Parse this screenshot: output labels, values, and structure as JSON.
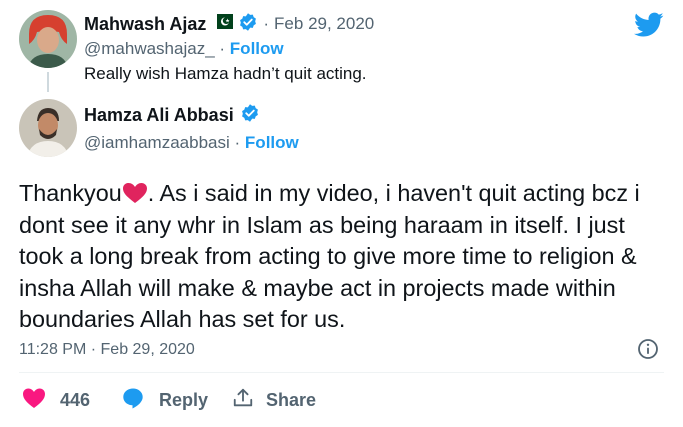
{
  "colors": {
    "brand_blue": "#1d9bf0",
    "like_pink": "#f91880",
    "text_primary": "#0f1419",
    "text_secondary": "#536471",
    "heart_red": "#e0245e"
  },
  "header_icon": "twitter-bird-icon",
  "parent_tweet": {
    "name": "Mahwash Ajaz",
    "flag_icon": "pakistan-flag-icon",
    "verified_icon": "verified-badge-icon",
    "date_sep": "·",
    "date": "Feb 29, 2020",
    "handle": "@mahwashajaz_",
    "dot": "·",
    "follow_label": "Follow",
    "text": "Really wish Hamza hadn’t quit acting."
  },
  "main_tweet": {
    "name": "Hamza Ali Abbasi",
    "verified_icon": "verified-badge-icon",
    "handle": "@iamhamzaabbasi",
    "dot": "·",
    "follow_label": "Follow",
    "text_prefix": "Thankyou",
    "heart_emoji": "❤️",
    "text_suffix": ". As i said in my video, i haven't quit acting bcz i dont see it any whr in Islam as being haraam in itself. I just took a long break from acting to give more time to religion & insha Allah will make & maybe act in projects made within boundaries Allah has set for us.",
    "timestamp": "11:28 PM · Feb 29, 2020",
    "info_icon": "info-icon"
  },
  "actions": {
    "like_count": "446",
    "reply_label": "Reply",
    "share_label": "Share"
  }
}
